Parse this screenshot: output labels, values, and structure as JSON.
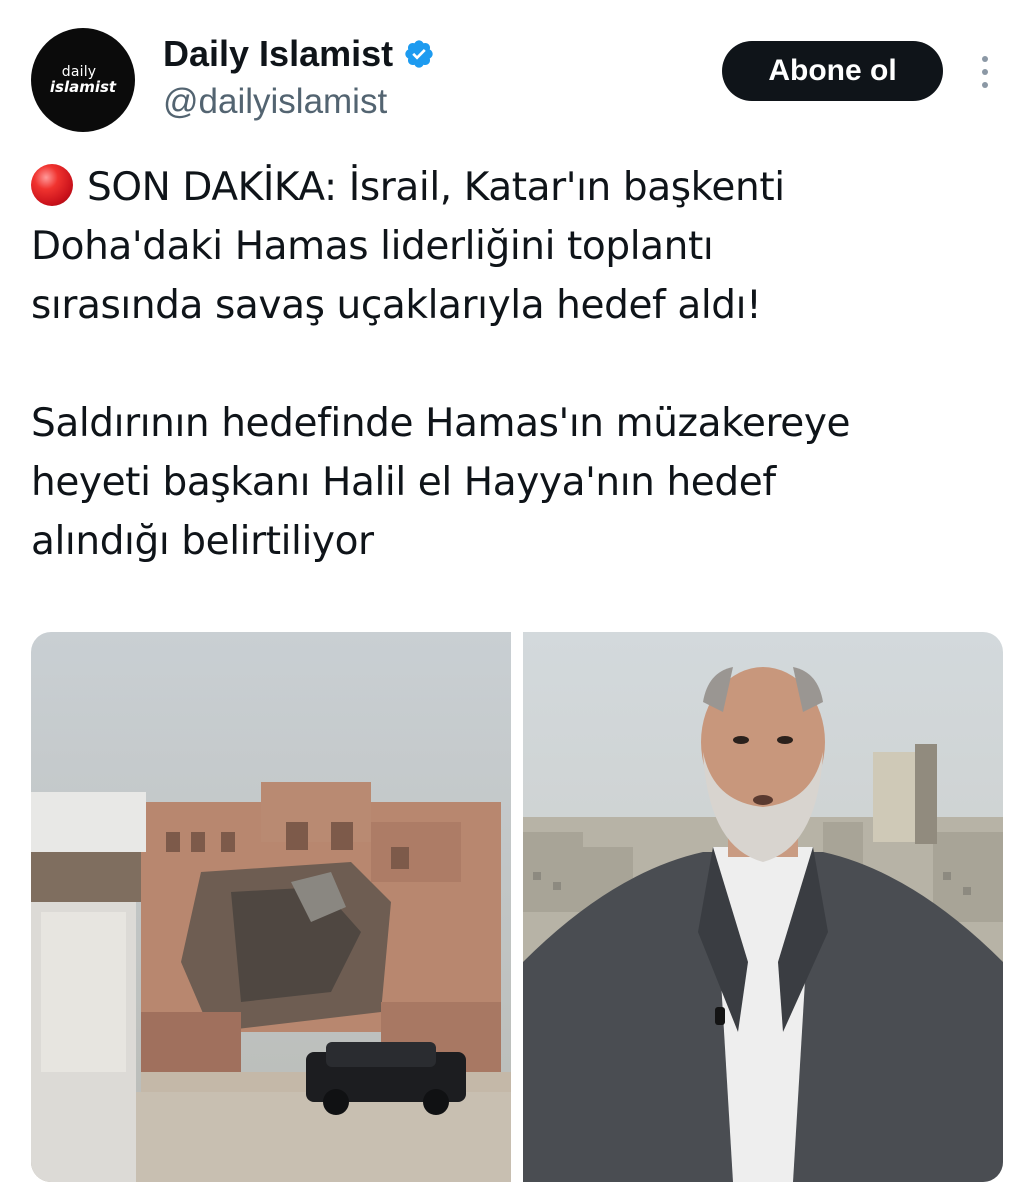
{
  "account": {
    "avatar_text_line1": "daily",
    "avatar_text_line2": "islamist",
    "display_name": "Daily Islamist",
    "handle": "@dailyislamist",
    "verified_icon": "verified-badge-icon",
    "verified_color": "#1d9bf0"
  },
  "actions": {
    "follow_label": "Abone ol",
    "more_icon": "more-vertical-icon"
  },
  "tweet": {
    "paragraph1_emoji": "red-circle-icon",
    "paragraph1": "SON DAKİKA: İsrail, Katar'ın başkenti\nDoha'daki Hamas liderliğini toplantı\nsırasında savaş uçaklarıyla hedef aldı!",
    "paragraph2": "Saldırının hedefinde Hamas'ın müzakereye\nheyeti başkanı Halil el Hayya'nın hedef\nalındığı belirtiliyor"
  },
  "media": {
    "count": 2,
    "images": [
      {
        "name": "damaged-building-photo"
      },
      {
        "name": "man-portrait-photo"
      }
    ]
  },
  "colors": {
    "text": "#0f1419",
    "secondary_text": "#536471",
    "button_bg": "#0f1419",
    "button_text": "#ffffff"
  }
}
